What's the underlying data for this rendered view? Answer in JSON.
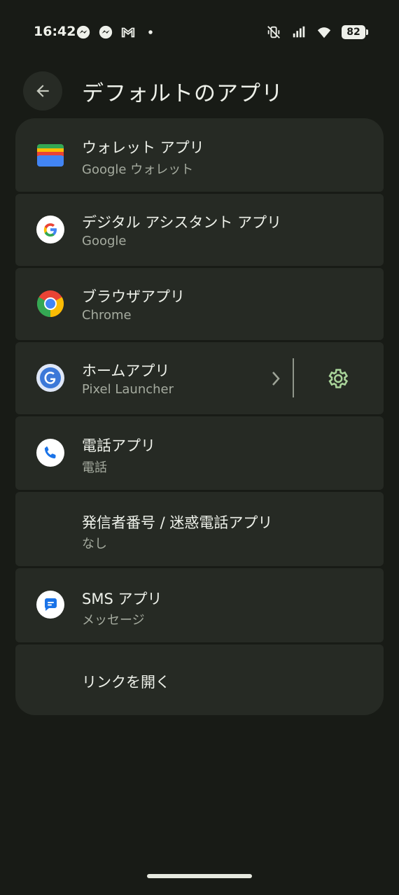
{
  "status_bar": {
    "time": "16:42",
    "left_icons": [
      "messenger-icon",
      "messenger-icon",
      "gmail-icon",
      "dot-icon"
    ],
    "right_icons": [
      "vibrate-off-icon",
      "signal-icon",
      "wifi-icon"
    ],
    "battery": "82"
  },
  "header": {
    "title": "デフォルトのアプリ",
    "back_icon": "arrow-back-icon"
  },
  "rows": [
    {
      "title": "ウォレット アプリ",
      "subtitle": "Google ウォレット",
      "icon": "google-wallet-icon"
    },
    {
      "title": "デジタル アシスタント アプリ",
      "subtitle": "Google",
      "icon": "google-icon"
    },
    {
      "title": "ブラウザアプリ",
      "subtitle": "Chrome",
      "icon": "chrome-icon"
    },
    {
      "title": "ホームアプリ",
      "subtitle": "Pixel Launcher",
      "icon": "pixel-launcher-icon",
      "trailing": [
        "chevron-right-icon",
        "gear-icon"
      ]
    },
    {
      "title": "電話アプリ",
      "subtitle": "電話",
      "icon": "phone-icon"
    },
    {
      "title": "発信者番号 / 迷惑電話アプリ",
      "subtitle": "なし",
      "icon": ""
    },
    {
      "title": "SMS アプリ",
      "subtitle": "メッセージ",
      "icon": "messages-icon"
    },
    {
      "title": "リンクを開く",
      "subtitle": "",
      "icon": ""
    }
  ],
  "colors": {
    "background": "#181b16",
    "card": "#262a24",
    "accent": "#a9d49a"
  }
}
